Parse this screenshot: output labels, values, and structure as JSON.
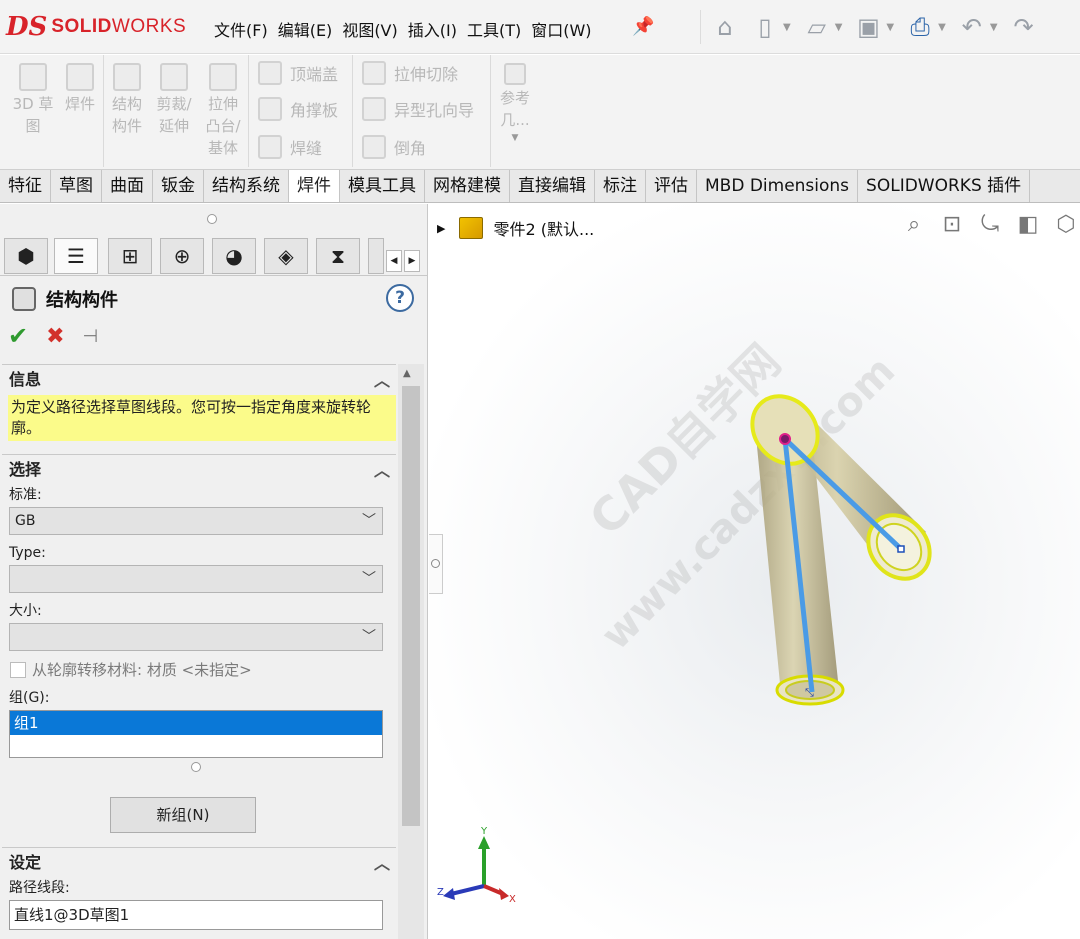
{
  "app": {
    "logo_prefix": "DS",
    "logo_solid": "SOLID",
    "logo_works": "WORKS"
  },
  "menu": [
    "文件(F)",
    "编辑(E)",
    "视图(V)",
    "插入(I)",
    "工具(T)",
    "窗口(W)"
  ],
  "quick_access": [
    "home-icon",
    "new-file-icon",
    "open-icon",
    "save-icon",
    "print-icon",
    "undo-icon",
    "redo-icon"
  ],
  "commands": {
    "sketch3d": "3D 草图",
    "weldment": "焊件",
    "structural_member": "结构构件",
    "trim_extend": "剪裁/延伸",
    "extruded_boss": "拉伸凸台/基体",
    "end_cap": "顶端盖",
    "gusset": "角撑板",
    "weld_bead": "焊缝",
    "extruded_cut": "拉伸切除",
    "hole_wizard": "异型孔向导",
    "chamfer": "倒角",
    "reference": "参考几..."
  },
  "tabs": [
    "特征",
    "草图",
    "曲面",
    "钣金",
    "结构系统",
    "焊件",
    "模具工具",
    "网格建模",
    "直接编辑",
    "标注",
    "评估",
    "MBD Dimensions",
    "SOLIDWORKS 插件"
  ],
  "active_tab": "焊件",
  "property_manager": {
    "title": "结构构件",
    "help": "?",
    "info": {
      "header": "信息",
      "text": "为定义路径选择草图线段。您可按一指定角度来旋转轮廓。"
    },
    "selection": {
      "header": "选择",
      "standard_label": "标准:",
      "standard_value": "GB",
      "type_label": "Type:",
      "type_value": "",
      "size_label": "大小:",
      "size_value": "",
      "transfer_material": "从轮廓转移材料: 材质 <未指定>",
      "group_label": "组(G):",
      "groups": [
        "组1"
      ],
      "new_group_button": "新组(N)"
    },
    "settings": {
      "header": "设定",
      "path_label": "路径线段:",
      "path_value": "直线1@3D草图1"
    }
  },
  "viewport": {
    "tree_item": "零件2 (默认...",
    "watermark_cn": "CAD自学网",
    "watermark_url": "www.cadzxw.com",
    "triad": {
      "x": "X",
      "y": "Y",
      "z": "Z"
    }
  }
}
